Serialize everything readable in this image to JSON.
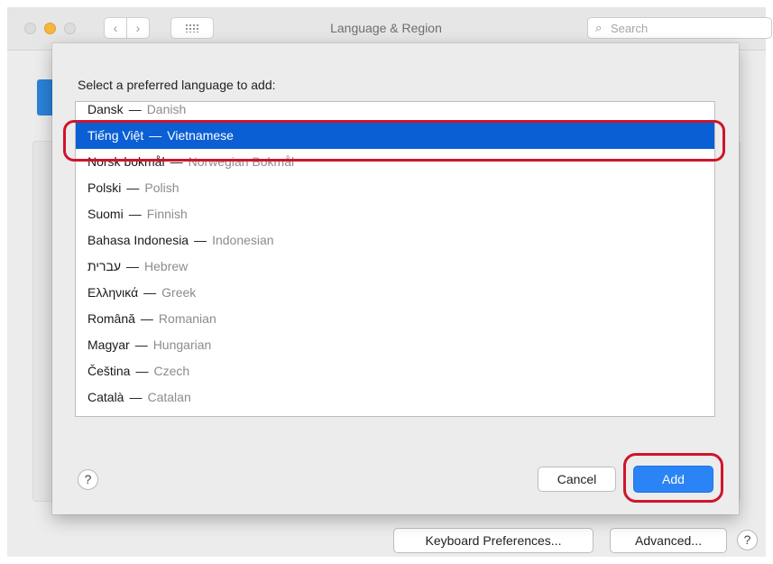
{
  "window": {
    "title": "Language & Region",
    "search_placeholder": "Search",
    "back_glyph": "‹",
    "forward_glyph": "›"
  },
  "sheet": {
    "prompt": "Select a preferred language to add:",
    "languages": [
      {
        "native": "Dansk",
        "english": "Danish",
        "selected": false
      },
      {
        "native": "Tiếng Việt",
        "english": "Vietnamese",
        "selected": true
      },
      {
        "native": "Norsk bokmål",
        "english": "Norwegian Bokmål",
        "selected": false
      },
      {
        "native": "Polski",
        "english": "Polish",
        "selected": false
      },
      {
        "native": "Suomi",
        "english": "Finnish",
        "selected": false
      },
      {
        "native": "Bahasa Indonesia",
        "english": "Indonesian",
        "selected": false
      },
      {
        "native": "עברית",
        "english": "Hebrew",
        "selected": false
      },
      {
        "native": "Ελληνικά",
        "english": "Greek",
        "selected": false
      },
      {
        "native": "Română",
        "english": "Romanian",
        "selected": false
      },
      {
        "native": "Magyar",
        "english": "Hungarian",
        "selected": false
      },
      {
        "native": "Čeština",
        "english": "Czech",
        "selected": false
      },
      {
        "native": "Català",
        "english": "Catalan",
        "selected": false
      }
    ],
    "separator": "—",
    "help": "?",
    "cancel_label": "Cancel",
    "add_label": "Add"
  },
  "footer": {
    "keyboard_label": "Keyboard Preferences...",
    "advanced_label": "Advanced...",
    "help": "?"
  },
  "colors": {
    "selection": "#0b5fd4",
    "annotation": "#d0142b",
    "add_button": "#2b84f6"
  }
}
